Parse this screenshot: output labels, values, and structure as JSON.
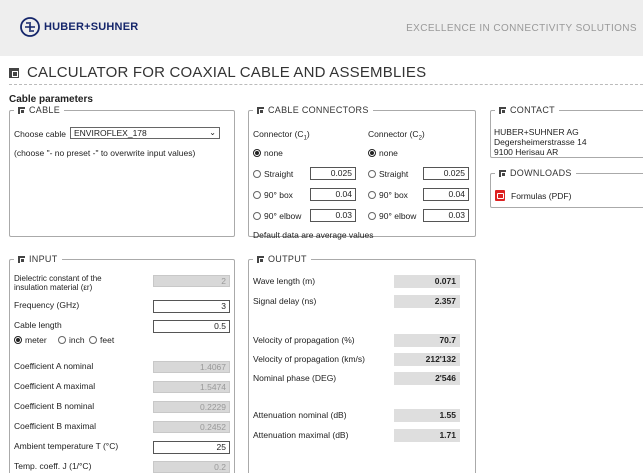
{
  "header": {
    "logo_text": "HUBER+SUHNER",
    "tagline": "EXCELLENCE IN CONNECTIVITY SOLUTIONS",
    "brand_color": "#15266b"
  },
  "title": "CALCULATOR FOR COAXIAL CABLE AND ASSEMBLIES",
  "cable_parameters_heading": "Cable parameters",
  "cable": {
    "legend": "CABLE",
    "choose_label": "Choose cable",
    "selected": "ENVIROFLEX_178",
    "hint": "(choose \"- no preset -\" to overwrite input values)"
  },
  "connectors": {
    "legend": "CABLE CONNECTORS",
    "col1_label": "Connector (C",
    "col1_sub": "1",
    "col2_label": "Connector (C",
    "col2_sub": "2",
    "close_paren": ")",
    "options": {
      "none": "none",
      "straight": "Straight",
      "box": "90° box",
      "elbow": "90° elbow"
    },
    "c1": {
      "selected": "none",
      "straight": "0.025",
      "box": "0.04",
      "elbow": "0.03"
    },
    "c2": {
      "selected": "none",
      "straight": "0.025",
      "box": "0.04",
      "elbow": "0.03"
    },
    "note": "Default data are average values"
  },
  "contact": {
    "legend": "CONTACT",
    "line1": "HUBER+SUHNER AG",
    "line2": "Degersheimerstrasse 14",
    "line3": "9100 Herisau AR"
  },
  "downloads": {
    "legend": "DOWNLOADS",
    "item": "Formulas (PDF)",
    "icon": "pdf-icon"
  },
  "input": {
    "legend": "INPUT",
    "dielectric_label": "Dielectric constant of the insulation material (εr)",
    "dielectric_value": "2",
    "frequency_label": "Frequency (GHz)",
    "frequency_value": "3",
    "length_label": "Cable length",
    "length_value": "0.5",
    "units": {
      "meter": "meter",
      "inch": "inch",
      "feet": "feet",
      "selected": "meter"
    },
    "coef_a_nom_label": "Coefficient A nominal",
    "coef_a_nom_value": "1.4067",
    "coef_a_max_label": "Coefficient A maximal",
    "coef_a_max_value": "1.5474",
    "coef_b_nom_label": "Coefficient B nominal",
    "coef_b_nom_value": "0.2229",
    "coef_b_max_label": "Coefficient B maximal",
    "coef_b_max_value": "0.2452",
    "ambient_label": "Ambient temperature T (°C)",
    "ambient_value": "25",
    "tempcoef_label": "Temp. coeff. J (1/°C)",
    "tempcoef_value": "0.2"
  },
  "output": {
    "legend": "OUTPUT",
    "wavelength_label": "Wave length (m)",
    "wavelength_value": "0.071",
    "delay_label": "Signal delay (ns)",
    "delay_value": "2.357",
    "vop_pct_label": "Velocity of propagation (%)",
    "vop_pct_value": "70.7",
    "vop_kms_label": "Velocity of propagation (km/s)",
    "vop_kms_value": "212'132",
    "phase_label": "Nominal phase (DEG)",
    "phase_value": "2'546",
    "att_nom_label": "Attenuation nominal (dB)",
    "att_nom_value": "1.55",
    "att_max_label": "Attenuation maximal (dB)",
    "att_max_value": "1.71"
  }
}
